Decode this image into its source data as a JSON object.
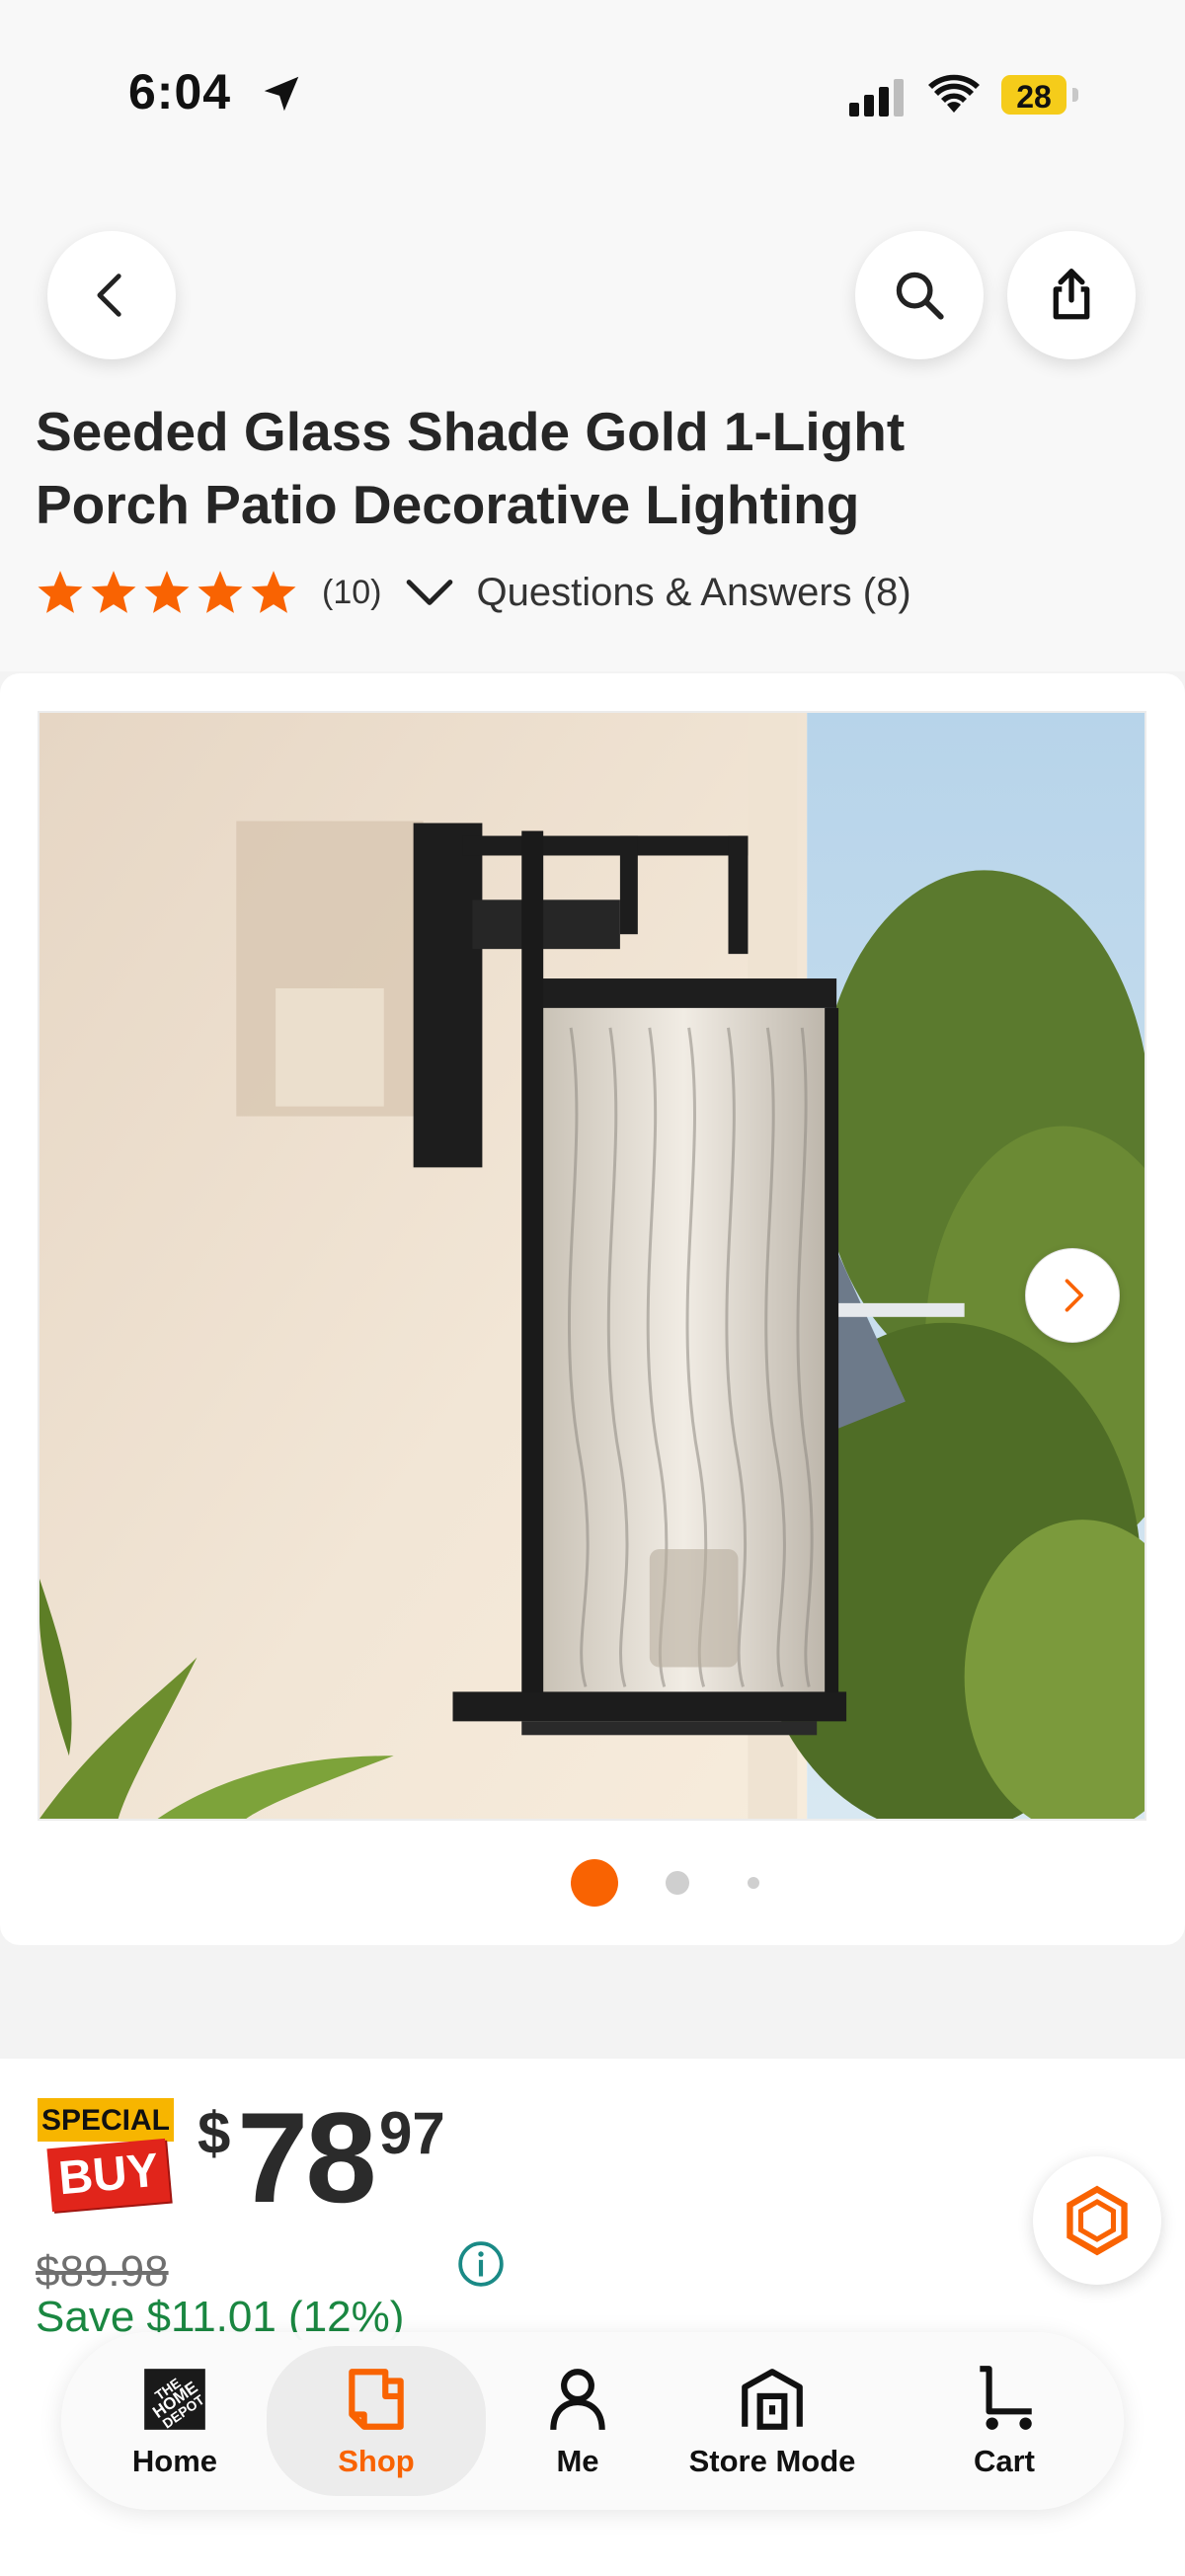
{
  "status_bar": {
    "time": "6:04",
    "battery": "28"
  },
  "header": {
    "back_icon": "chevron-left-icon",
    "search_icon": "search-icon",
    "share_icon": "share-icon"
  },
  "product": {
    "title": "Seeded Glass Shade Gold 1-Light Porch Patio Decorative Lighting",
    "rating": 5,
    "review_count": "(10)",
    "qa_label": "Questions & Answers (8)"
  },
  "gallery": {
    "image_count": 3,
    "active_index": 0
  },
  "pricing": {
    "badge_top": "SPECIAL",
    "badge_bottom": "BUY",
    "currency": "$",
    "dollars": "78",
    "cents": "97",
    "was_price": "$89.98",
    "savings": "Save $11.01 (12%)"
  },
  "nav": {
    "items": [
      {
        "label": "Home",
        "icon": "home-depot-logo-icon"
      },
      {
        "label": "Shop",
        "icon": "shop-icon",
        "active": true
      },
      {
        "label": "Me",
        "icon": "person-icon"
      },
      {
        "label": "Store Mode",
        "icon": "store-icon"
      },
      {
        "label": "Cart",
        "icon": "cart-icon"
      }
    ]
  },
  "colors": {
    "brand_orange": "#f96302",
    "save_green": "#1a8741",
    "special_red": "#e1251b",
    "special_yellow": "#f7b500"
  }
}
